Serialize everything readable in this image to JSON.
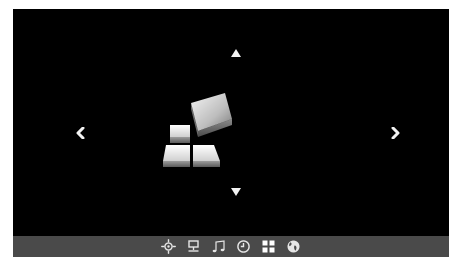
{
  "accent_color": "#ffffff",
  "taskbar_color": "#4a4a4a",
  "background_color": "#000000",
  "navigation": {
    "up_icon": "triangle-up-icon",
    "down_icon": "triangle-down-icon",
    "left_icon": "chevron-left-icon",
    "right_icon": "chevron-right-icon"
  },
  "main_tile": {
    "icon": "apps-blocks-icon",
    "selected": true
  },
  "taskbar": {
    "items": [
      {
        "icon": "settings-icon",
        "active": false
      },
      {
        "icon": "network-icon",
        "active": false
      },
      {
        "icon": "music-icon",
        "active": false
      },
      {
        "icon": "clock-icon",
        "active": false
      },
      {
        "icon": "apps-grid-icon",
        "active": true
      },
      {
        "icon": "globe-icon",
        "active": false
      }
    ]
  }
}
